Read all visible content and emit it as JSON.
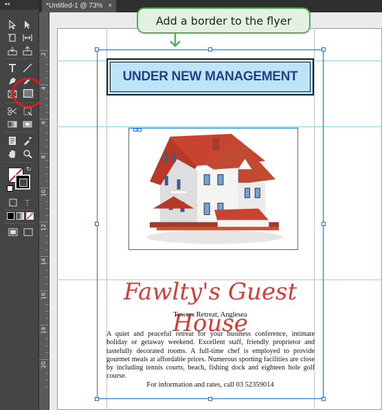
{
  "document_tab": {
    "title": "*Untitled-1 @ 73%",
    "close_label": "×"
  },
  "callout": {
    "text": "Add a border to the flyer"
  },
  "ruler": {
    "labels": [
      "2",
      "4",
      "6",
      "8",
      "10",
      "12",
      "14",
      "16",
      "18",
      "20"
    ]
  },
  "flyer": {
    "banner": "UNDER NEW MANAGEMENT",
    "title": "Fawlty's Guest House",
    "subtitle": "Towers Retreat, Anglesea",
    "body": "A quiet and peaceful retreat for your business conference, intimate holiday or getaway weekend.  Excellent staff, friendly proprietor and tastefully decorated rooms.  A full-time chef is employed to provide gourmet meals at affordable prices.  Numerous sporting facilities are close by including tennis courts, beach, fishing dock and eighteen hole golf course.",
    "footer": "For information and rates, call 03 52359014"
  },
  "toolbar": {
    "fill_label": "T",
    "highlight_color": "#e0181b"
  },
  "colors": {
    "banner_fill": "#bde5f7",
    "banner_text": "#21418a",
    "title_red": "#d93a33",
    "selection_blue": "#1f6fd1",
    "callout_green": "#4fae5d"
  }
}
